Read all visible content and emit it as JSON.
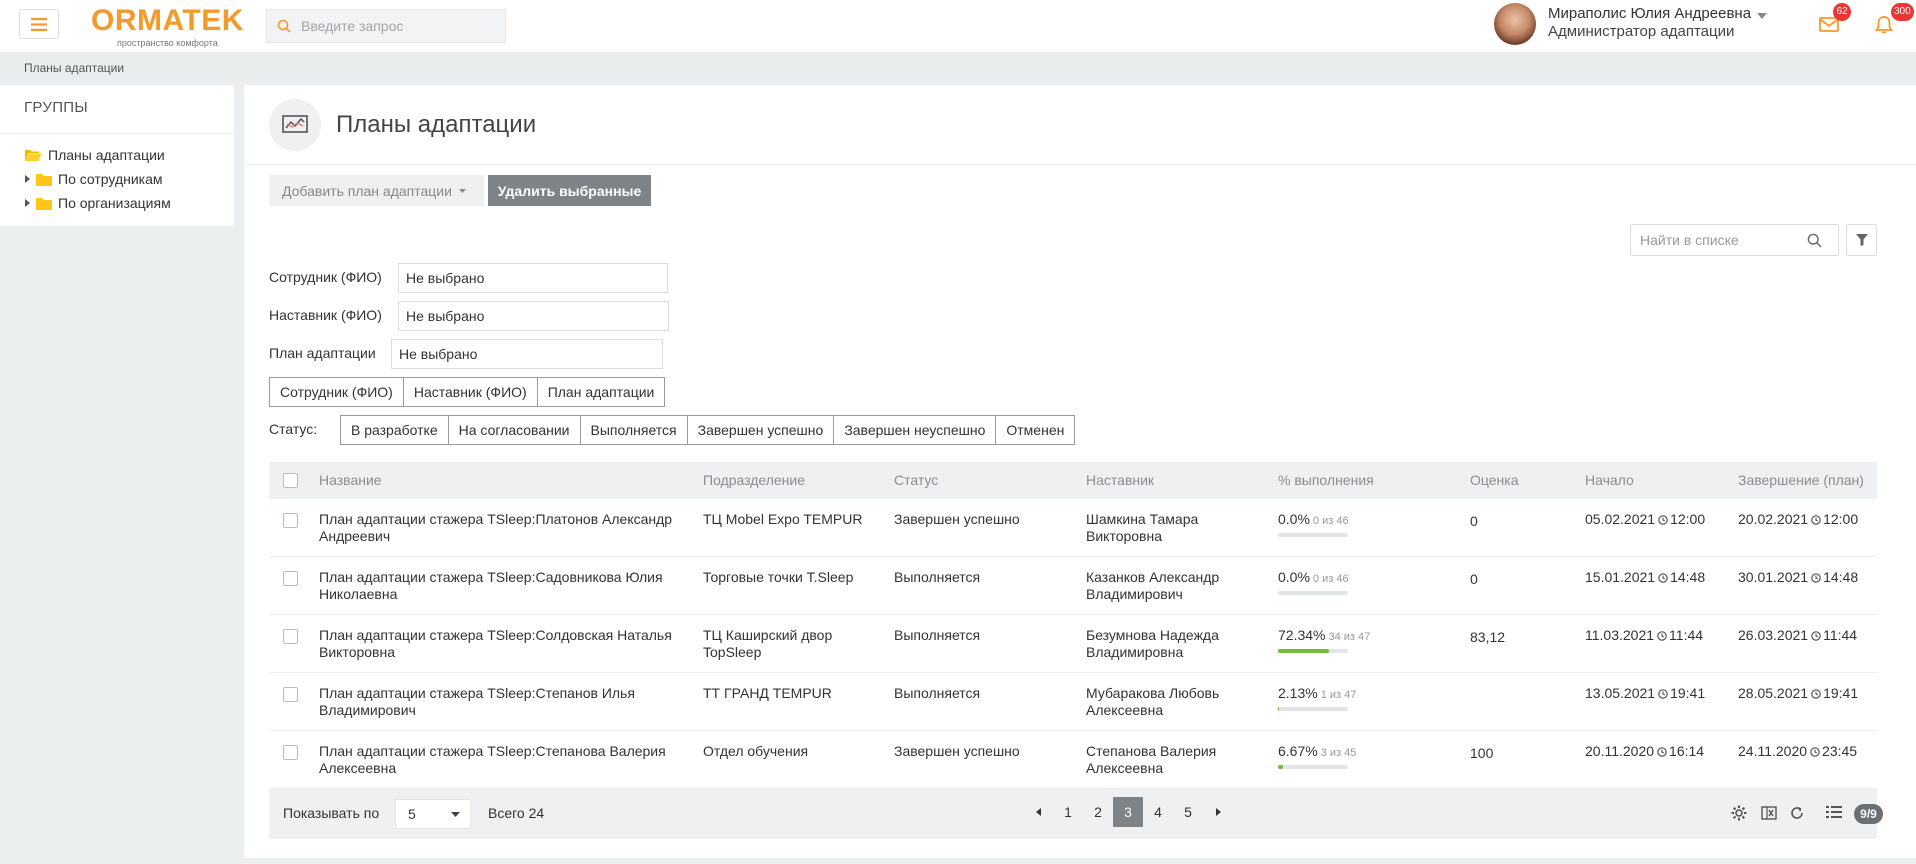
{
  "header": {
    "logo_text": "ORMATEK",
    "logo_tagline": "пространство комфорта",
    "search_placeholder": "Введите запрос",
    "user_name": "Мираполис Юлия Андреевна",
    "user_role": "Администратор адаптации",
    "mail_badge": "62",
    "bell_badge": "300"
  },
  "breadcrumb": "Планы адаптации",
  "sidebar": {
    "title": "ГРУППЫ",
    "items": [
      {
        "label": "Планы адаптации"
      },
      {
        "label": "По сотрудникам"
      },
      {
        "label": "По организациям"
      }
    ]
  },
  "page": {
    "title": "Планы адаптации",
    "add_button": "Добавить план адаптации",
    "delete_button": "Удалить выбранные",
    "list_search_placeholder": "Найти в списке"
  },
  "filters": {
    "employee_label": "Сотрудник (ФИО)",
    "employee_value": "Не выбрано",
    "mentor_label": "Наставник (ФИО)",
    "mentor_value": "Не выбрано",
    "plan_label": "План адаптации",
    "plan_value": "Не выбрано",
    "group_buttons": [
      "Сотрудник (ФИО)",
      "Наставник (ФИО)",
      "План адаптации"
    ],
    "status_label": "Статус:",
    "status_buttons": [
      "В разработке",
      "На согласовании",
      "Выполняется",
      "Завершен успешно",
      "Завершен неуспешно",
      "Отменен"
    ]
  },
  "table": {
    "columns": [
      "Название",
      "Подразделение",
      "Статус",
      "Наставник",
      "% выполнения",
      "Оценка",
      "Начало",
      "Завершение (план)"
    ],
    "rows": [
      {
        "name": "План адаптации стажера TSleep:Платонов Александр Андреевич",
        "dept": "ТЦ Mobel Expo TEMPUR",
        "status": "Завершен успешно",
        "mentor": "Шамкина Тамара Викторовна",
        "pct": "0.0%",
        "pct_of": "0 из 46",
        "pct_value": 0,
        "score": "0",
        "start_date": "05.02.2021",
        "start_time": "12:00",
        "end_date": "20.02.2021",
        "end_time": "12:00"
      },
      {
        "name": "План адаптации стажера TSleep:Садовникова Юлия Николаевна",
        "dept": "Торговые точки T.Sleep",
        "status": "Выполняется",
        "mentor": "Казанков Александр Владимирович",
        "pct": "0.0%",
        "pct_of": "0 из 46",
        "pct_value": 0,
        "score": "0",
        "start_date": "15.01.2021",
        "start_time": "14:48",
        "end_date": "30.01.2021",
        "end_time": "14:48"
      },
      {
        "name": "План адаптации стажера TSleep:Солдовская Наталья Викторовна",
        "dept": "ТЦ Каширский двор TopSleep",
        "status": "Выполняется",
        "mentor": "Безумнова Надежда Владимировна",
        "pct": "72.34%",
        "pct_of": "34 из 47",
        "pct_value": 72.34,
        "score": "83,12",
        "start_date": "11.03.2021",
        "start_time": "11:44",
        "end_date": "26.03.2021",
        "end_time": "11:44"
      },
      {
        "name": "План адаптации стажера TSleep:Степанов Илья Владимирович",
        "dept": "ТТ ГРАНД TEMPUR",
        "status": "Выполняется",
        "mentor": "Мубаракова Любовь Алексеевна",
        "pct": "2.13%",
        "pct_of": "1 из 47",
        "pct_value": 2.13,
        "score": "",
        "start_date": "13.05.2021",
        "start_time": "19:41",
        "end_date": "28.05.2021",
        "end_time": "19:41"
      },
      {
        "name": "План адаптации стажера TSleep:Степанова Валерия Алексеевна",
        "dept": "Отдел обучения",
        "status": "Завершен успешно",
        "mentor": "Степанова Валерия Алексеевна",
        "pct": "6.67%",
        "pct_of": "3 из 45",
        "pct_value": 6.67,
        "score": "100",
        "start_date": "20.11.2020",
        "start_time": "16:14",
        "end_date": "24.11.2020",
        "end_time": "23:45"
      }
    ]
  },
  "footer": {
    "show_label": "Показывать по",
    "per_page": "5",
    "total": "Всего 24",
    "pages": [
      "1",
      "2",
      "3",
      "4",
      "5"
    ],
    "current_page": "3",
    "columns_badge": "9/9"
  },
  "colors": {
    "brand": "#f39a2c",
    "active": "#7d8387",
    "progress": "#6cbf3a",
    "badge": "#e53935"
  }
}
